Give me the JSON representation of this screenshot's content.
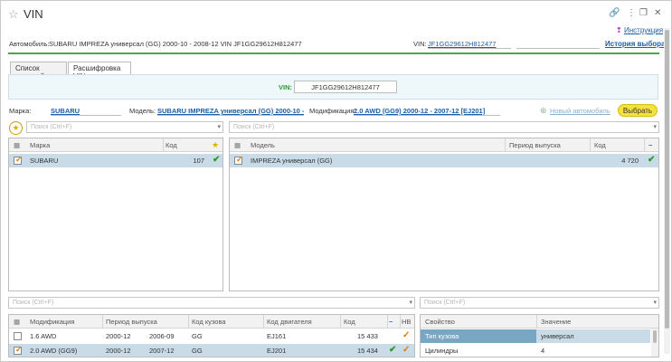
{
  "window": {
    "title": "VIN",
    "instruction_label": "Инструкция",
    "history_label": "История выбора"
  },
  "header": {
    "car_label": "Автомобиль:",
    "car_value": "SUBARU IMPREZA универсал (GG) 2000-10 - 2008-12 VIN JF1GG29612H812477",
    "vin_label": "VIN:",
    "vin_value": "JF1GG29612H812477"
  },
  "tabs": [
    {
      "label": "Список моделей"
    },
    {
      "label": "Расшифровка VIN"
    }
  ],
  "vin_panel": {
    "label": "VIN:",
    "value": "JF1GG29612H812477"
  },
  "selection": {
    "brand_label": "Марка:",
    "brand_value": "SUBARU",
    "model_label": "Модель:",
    "model_value": "SUBARU IMPREZA универсал (GG) 2000-10 - ...",
    "mod_label": "Модификация:",
    "mod_value": "2.0 AWD (GG9) 2000-12 - 2007-12 [EJ201]",
    "new_car_label": "Новый автомобиль",
    "select_button": "Выбрать"
  },
  "search": {
    "placeholder": "Поиск (Ctrl+F)"
  },
  "brands": {
    "columns": [
      "Марка",
      "Код"
    ],
    "rows": [
      {
        "name": "SUBARU",
        "code": "107"
      }
    ]
  },
  "models": {
    "columns": [
      "Модель",
      "Период выпуска",
      "Код"
    ],
    "rows": [
      {
        "name": "IMPREZA универсал (GG)",
        "period": "",
        "code": "4 720"
      }
    ]
  },
  "modifications": {
    "columns": [
      "Модификация",
      "Период выпуска",
      "Код кузова",
      "Код двигателя",
      "Код",
      "НВ"
    ],
    "rows": [
      {
        "name": "1.6 AWD",
        "from": "2000-12",
        "to": "2006-09",
        "body": "GG",
        "engine": "EJ161",
        "code": "15 433"
      },
      {
        "name": "2.0 AWD (GG9)",
        "from": "2000-12",
        "to": "2007-12",
        "body": "GG",
        "engine": "EJ201",
        "code": "15 434"
      }
    ]
  },
  "properties": {
    "columns": [
      "Свойство",
      "Значение"
    ],
    "rows": [
      {
        "name": "Тип кузова",
        "value": "универсал"
      },
      {
        "name": "Цилиндры",
        "value": "4"
      }
    ]
  }
}
